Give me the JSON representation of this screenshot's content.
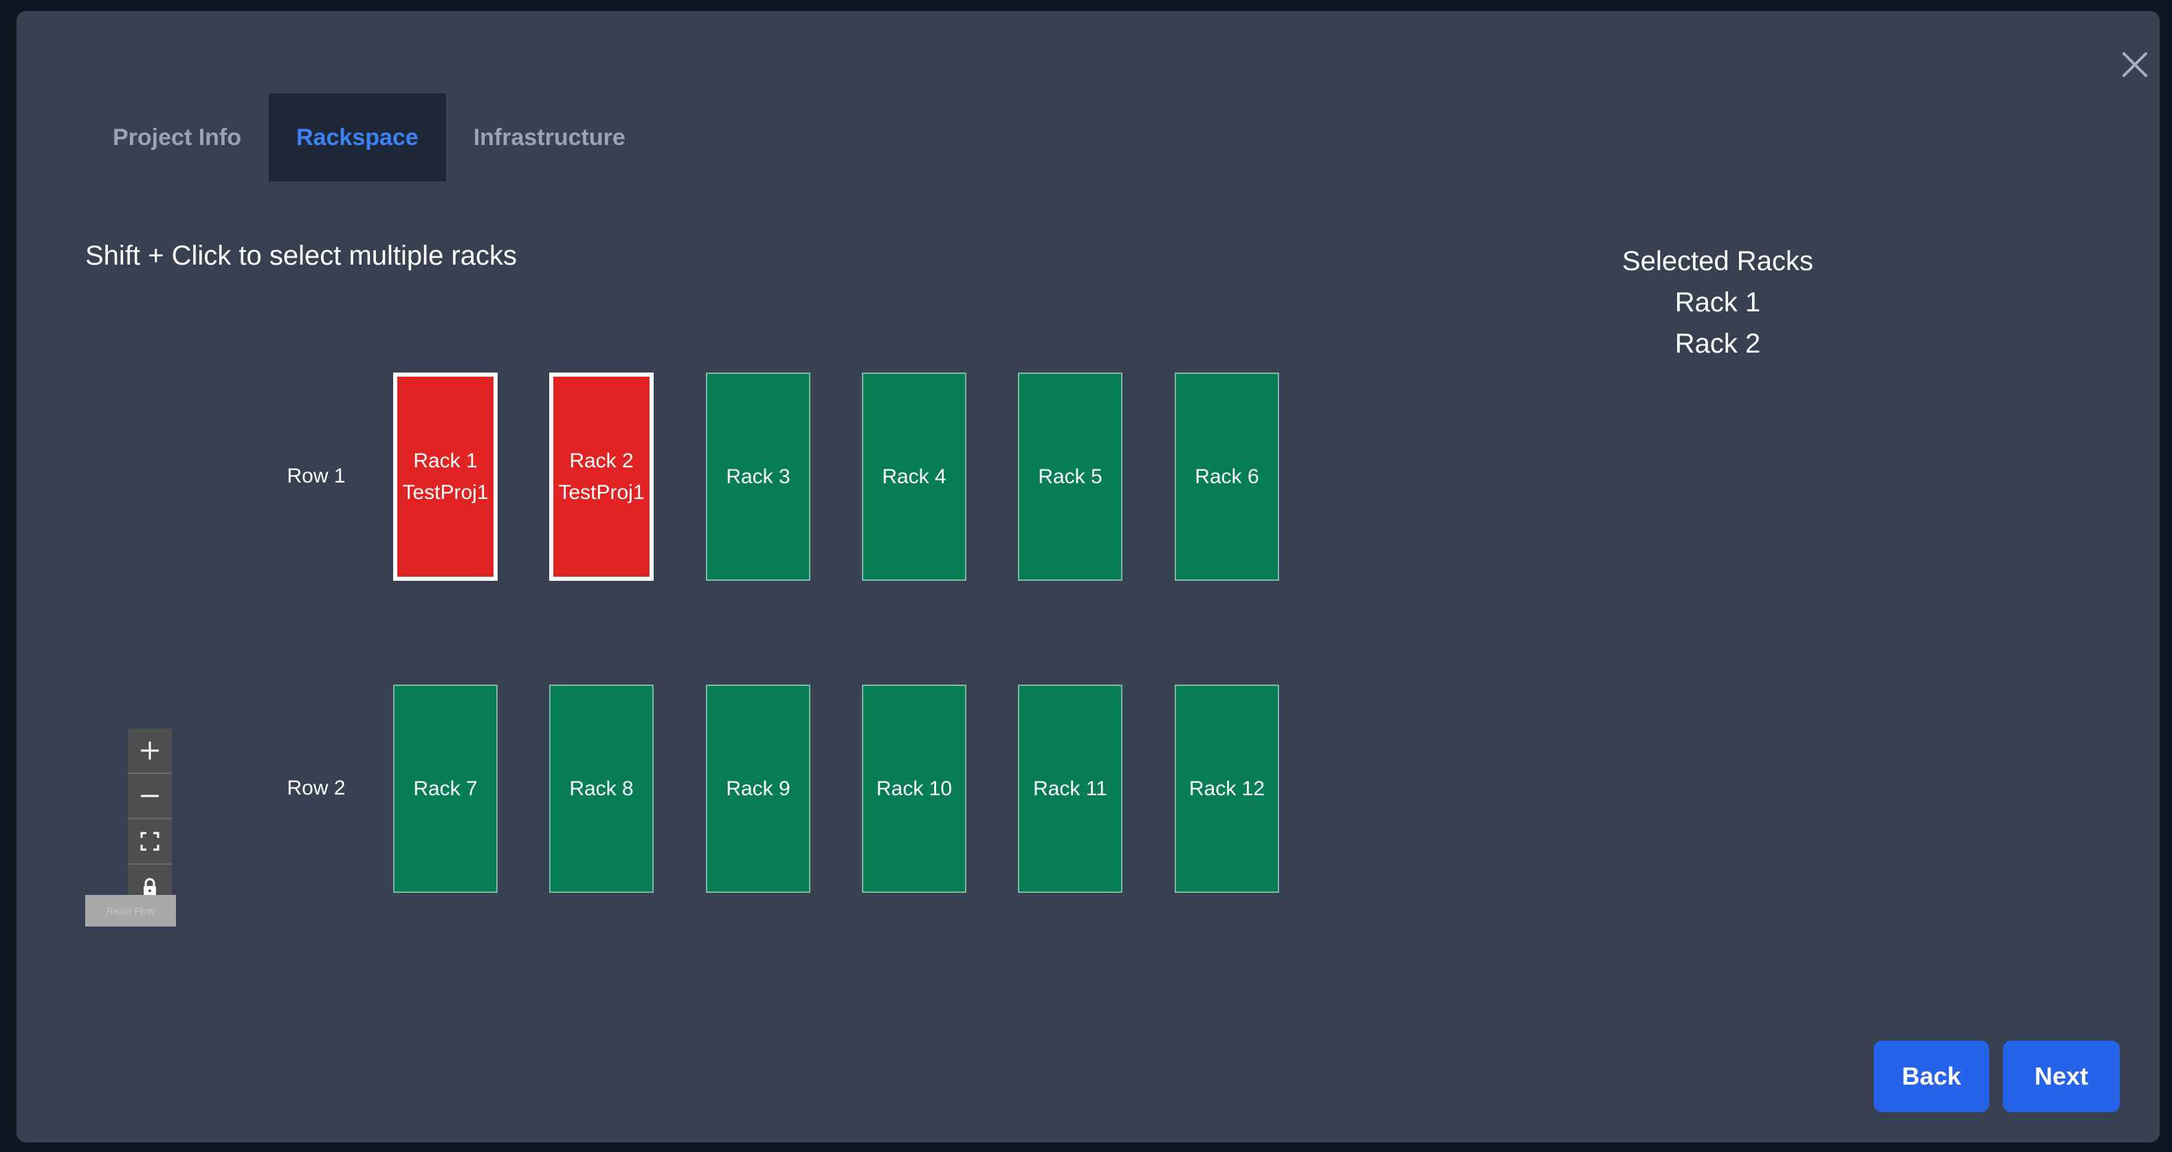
{
  "tabs": [
    {
      "label": "Project Info",
      "active": false
    },
    {
      "label": "Rackspace",
      "active": true
    },
    {
      "label": "Infrastructure",
      "active": false
    }
  ],
  "hint": "Shift + Click to select multiple racks",
  "selected": {
    "title": "Selected Racks",
    "items": [
      "Rack 1",
      "Rack 2"
    ]
  },
  "rows": [
    {
      "label": "Row 1",
      "racks": [
        {
          "name": "Rack 1",
          "project": "TestProj1",
          "status": "reserved"
        },
        {
          "name": "Rack 2",
          "project": "TestProj1",
          "status": "reserved"
        },
        {
          "name": "Rack 3",
          "project": "",
          "status": "available"
        },
        {
          "name": "Rack 4",
          "project": "",
          "status": "available"
        },
        {
          "name": "Rack 5",
          "project": "",
          "status": "available"
        },
        {
          "name": "Rack 6",
          "project": "",
          "status": "available"
        }
      ]
    },
    {
      "label": "Row 2",
      "racks": [
        {
          "name": "Rack 7",
          "project": "",
          "status": "available"
        },
        {
          "name": "Rack 8",
          "project": "",
          "status": "available"
        },
        {
          "name": "Rack 9",
          "project": "",
          "status": "available"
        },
        {
          "name": "Rack 10",
          "project": "",
          "status": "available"
        },
        {
          "name": "Rack 11",
          "project": "",
          "status": "available"
        },
        {
          "name": "Rack 12",
          "project": "",
          "status": "available"
        }
      ]
    }
  ],
  "zoom_controls": [
    "plus-icon",
    "minus-icon",
    "fit-view-icon",
    "lock-icon"
  ],
  "attribution": "React Flow",
  "buttons": {
    "back": "Back",
    "next": "Next"
  },
  "colors": {
    "available": "#067d55",
    "reserved": "#e12323",
    "accent": "#3b82f6",
    "button": "#2563eb",
    "modal_bg": "#384152"
  }
}
